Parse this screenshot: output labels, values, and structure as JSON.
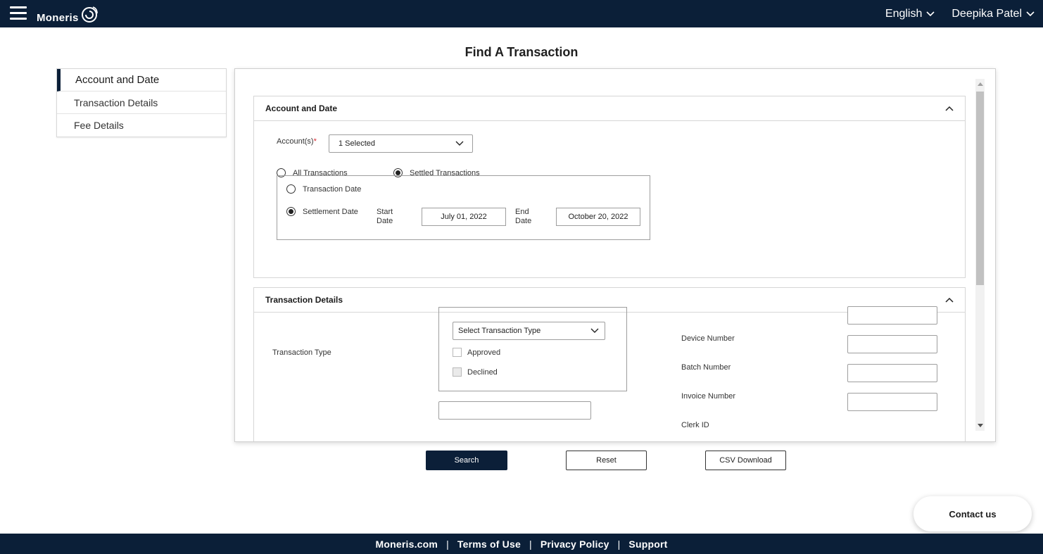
{
  "header": {
    "logo_text": "Moneris",
    "language": "English",
    "user_name": "Deepika Patel"
  },
  "page": {
    "title": "Find A Transaction"
  },
  "sidebar": {
    "items": [
      {
        "label": "Account and Date",
        "active": true
      },
      {
        "label": "Transaction Details",
        "active": false
      },
      {
        "label": "Fee Details",
        "active": false
      }
    ]
  },
  "account_section": {
    "title": "Account and Date",
    "accounts_label": "Account(s)",
    "required_mark": "*",
    "accounts_value": "1 Selected",
    "filter_options": [
      {
        "label": "All Transactions",
        "checked": false
      },
      {
        "label": "Settled Transactions",
        "checked": true
      }
    ],
    "date_type_options": [
      {
        "label": "Transaction Date",
        "checked": false
      },
      {
        "label": "Settlement Date",
        "checked": true
      }
    ],
    "start_date_label": "Start Date",
    "start_date_value": "July 01, 2022",
    "end_date_label": "End Date",
    "end_date_value": "October 20, 2022"
  },
  "details_section": {
    "title": "Transaction Details",
    "transaction_type_label": "Transaction Type",
    "transaction_type_placeholder": "Select Transaction Type",
    "status_options": [
      {
        "label": "Approved",
        "checked": false
      },
      {
        "label": "Declined",
        "checked": false
      }
    ],
    "right_fields": [
      {
        "label": "Device Number",
        "value": ""
      },
      {
        "label": "Batch Number",
        "value": ""
      },
      {
        "label": "Invoice Number",
        "value": ""
      },
      {
        "label": "Clerk ID",
        "value": ""
      }
    ]
  },
  "actions": {
    "search_label": "Search",
    "reset_label": "Reset",
    "csv_label": "CSV Download"
  },
  "contact_label": "Contact us",
  "footer": {
    "links": [
      "Moneris.com",
      "Terms of Use",
      "Privacy Policy",
      "Support"
    ],
    "separator": "|"
  },
  "colors": {
    "navy": "#0b1f38",
    "required": "#d8262e"
  }
}
